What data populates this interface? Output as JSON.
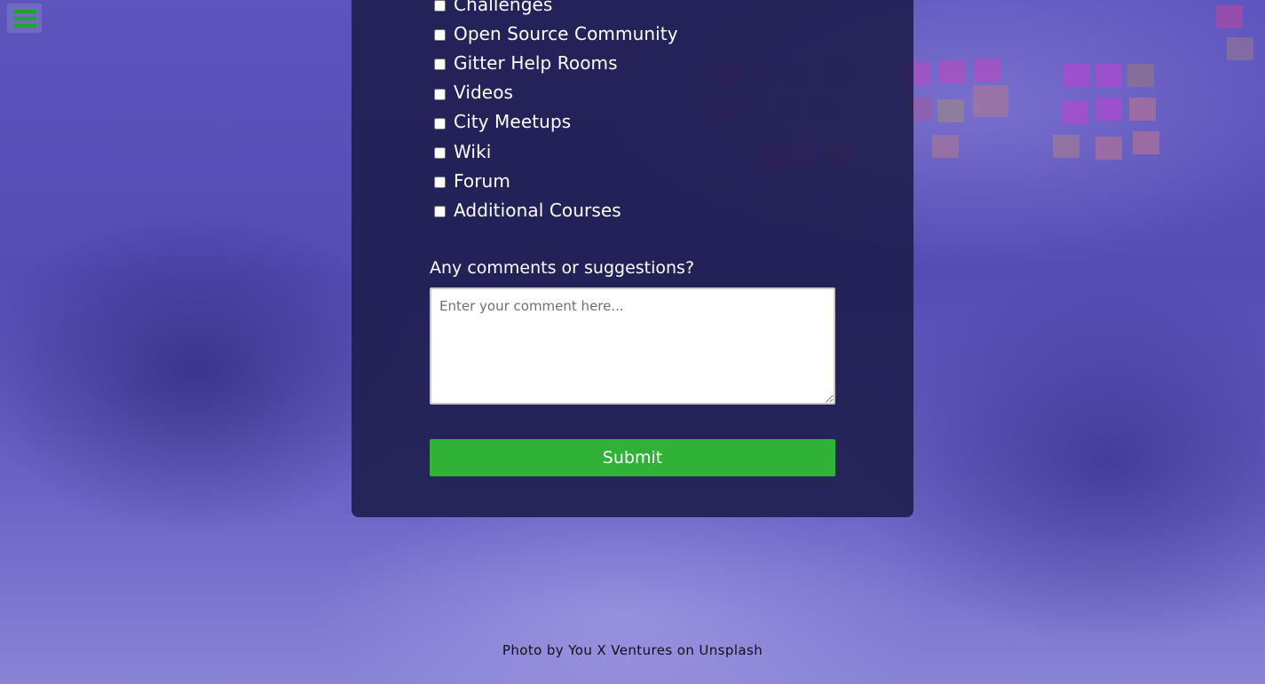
{
  "form": {
    "options": [
      {
        "label": "Challenges",
        "checked": false
      },
      {
        "label": "Open Source Community",
        "checked": false
      },
      {
        "label": "Gitter Help Rooms",
        "checked": false
      },
      {
        "label": "Videos",
        "checked": false
      },
      {
        "label": "City Meetups",
        "checked": false
      },
      {
        "label": "Wiki",
        "checked": false
      },
      {
        "label": "Forum",
        "checked": false
      },
      {
        "label": "Additional Courses",
        "checked": false
      }
    ],
    "comments_label": "Any comments or suggestions?",
    "comments_placeholder": "Enter your comment here...",
    "comments_value": "",
    "submit_label": "Submit"
  },
  "footer": {
    "photo_credit": "Photo by You X Ventures on Unsplash"
  },
  "colors": {
    "accent": "#2fb236",
    "panel": "#1b1b48",
    "background_overlay": "#5d55bd"
  },
  "icons": {
    "menu": "hamburger-menu-icon"
  }
}
